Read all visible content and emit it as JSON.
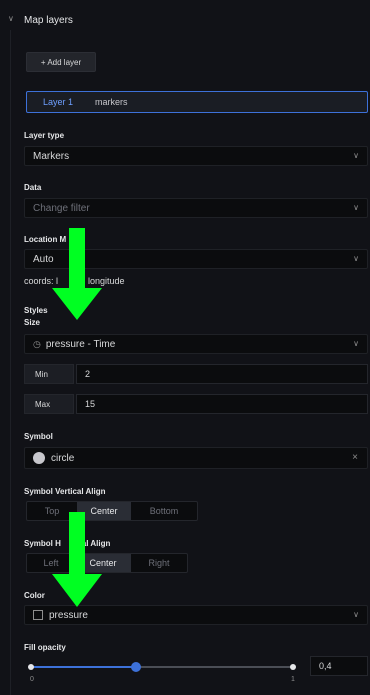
{
  "header": {
    "title": "Map layers"
  },
  "add_layer": {
    "label": "+ Add layer"
  },
  "layer": {
    "name": "Layer 1",
    "value": "markers"
  },
  "layer_type": {
    "label": "Layer type",
    "value": "Markers"
  },
  "data": {
    "label": "Data",
    "placeholder": "Change filter"
  },
  "location": {
    "label": "Location M",
    "value": "Auto",
    "note": "coords: l      de, longitude"
  },
  "styles": {
    "label": "Styles"
  },
  "size": {
    "label": "Size",
    "value": "pressure - Time",
    "min_label": "Min",
    "min_value": "2",
    "max_label": "Max",
    "max_value": "15"
  },
  "symbol": {
    "label": "Symbol",
    "value": "circle"
  },
  "symbol_valign": {
    "label": "Symbol Vertical Align",
    "options": [
      "Top",
      "Center",
      "Bottom"
    ],
    "selected": "Center"
  },
  "symbol_halign": {
    "label": "Symbol H      ntal Align",
    "options": [
      "Left",
      "Center",
      "Right"
    ],
    "selected": "Center"
  },
  "color": {
    "label": "Color",
    "value": "pressure"
  },
  "fill_opacity": {
    "label": "Fill opacity",
    "value": 0.4,
    "display_value": "0,4",
    "min_tick": "0",
    "max_tick": "1"
  },
  "colors": {
    "accent": "#3d71d9",
    "highlight_arrow": "#00ff22",
    "background": "#111217"
  }
}
